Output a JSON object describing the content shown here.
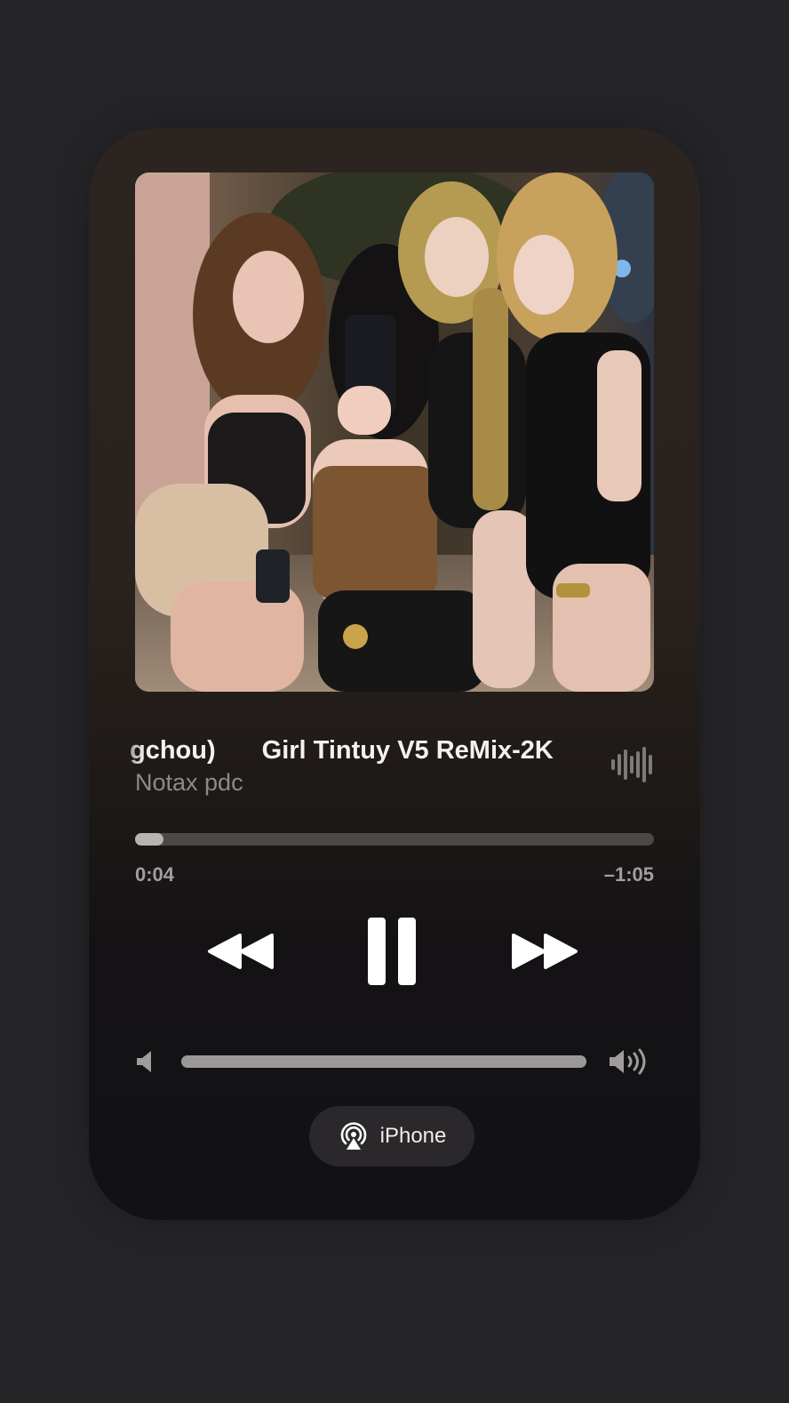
{
  "artwork": {
    "description_icon": "album-artwork-photo"
  },
  "track": {
    "title_tail": "gchou)",
    "title": "Girl Tintuy V5 ReMix-2K",
    "artist": "Notax pdc"
  },
  "playback": {
    "elapsed": "0:04",
    "remaining": "–1:05",
    "progress_fraction": 0.055
  },
  "controls": {
    "rewind_icon": "rewind-icon",
    "pause_icon": "pause-icon",
    "forward_icon": "fast-forward-icon"
  },
  "volume": {
    "level_fraction": 1.0,
    "low_icon": "speaker-low-icon",
    "high_icon": "speaker-high-icon"
  },
  "route": {
    "icon": "airplay-icon",
    "label": "iPhone"
  },
  "colors": {
    "accent_text": "#f4f2f0",
    "secondary_text": "#8f8a88",
    "track": "#4b4848",
    "fill": "#b8b4b4"
  }
}
